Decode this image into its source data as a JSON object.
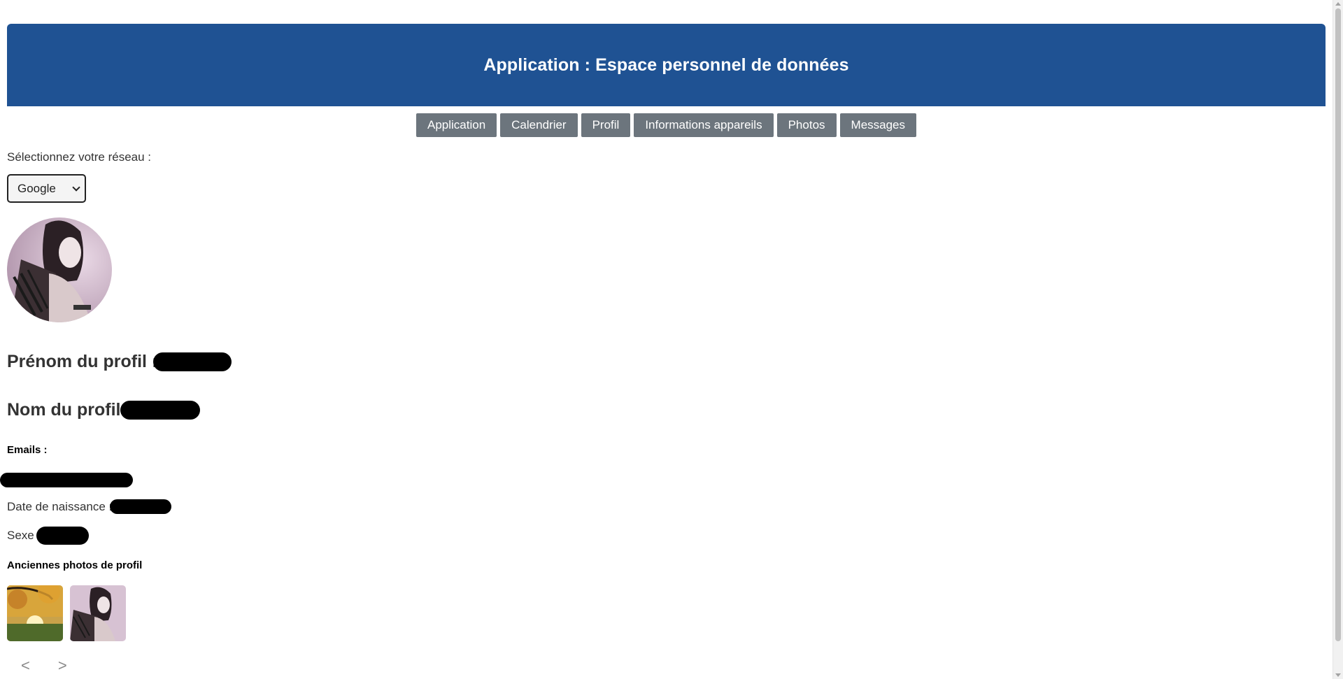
{
  "header": {
    "title": "Application : Espace personnel de données",
    "background_color": "#1f5293"
  },
  "nav": {
    "items": [
      {
        "label": "Application"
      },
      {
        "label": "Calendrier"
      },
      {
        "label": "Profil"
      },
      {
        "label": "Informations appareils"
      },
      {
        "label": "Photos"
      },
      {
        "label": "Messages"
      }
    ],
    "button_color": "#6c757d"
  },
  "network": {
    "label": "Sélectionnez votre réseau :",
    "selected": "Google"
  },
  "profile": {
    "avatar_icon": "profile-avatar-image",
    "first_name_label": "Prénom du profil :",
    "last_name_label": "Nom du profil :",
    "emails_label": "Emails :",
    "birthdate_label": "Date de naissance :",
    "sex_label": "Sexe :"
  },
  "old_photos": {
    "title": "Anciennes photos de profil",
    "thumbs": [
      {
        "icon": "autumn-landscape-thumbnail"
      },
      {
        "icon": "profile-portrait-thumbnail"
      }
    ],
    "prev": "<",
    "next": ">"
  }
}
